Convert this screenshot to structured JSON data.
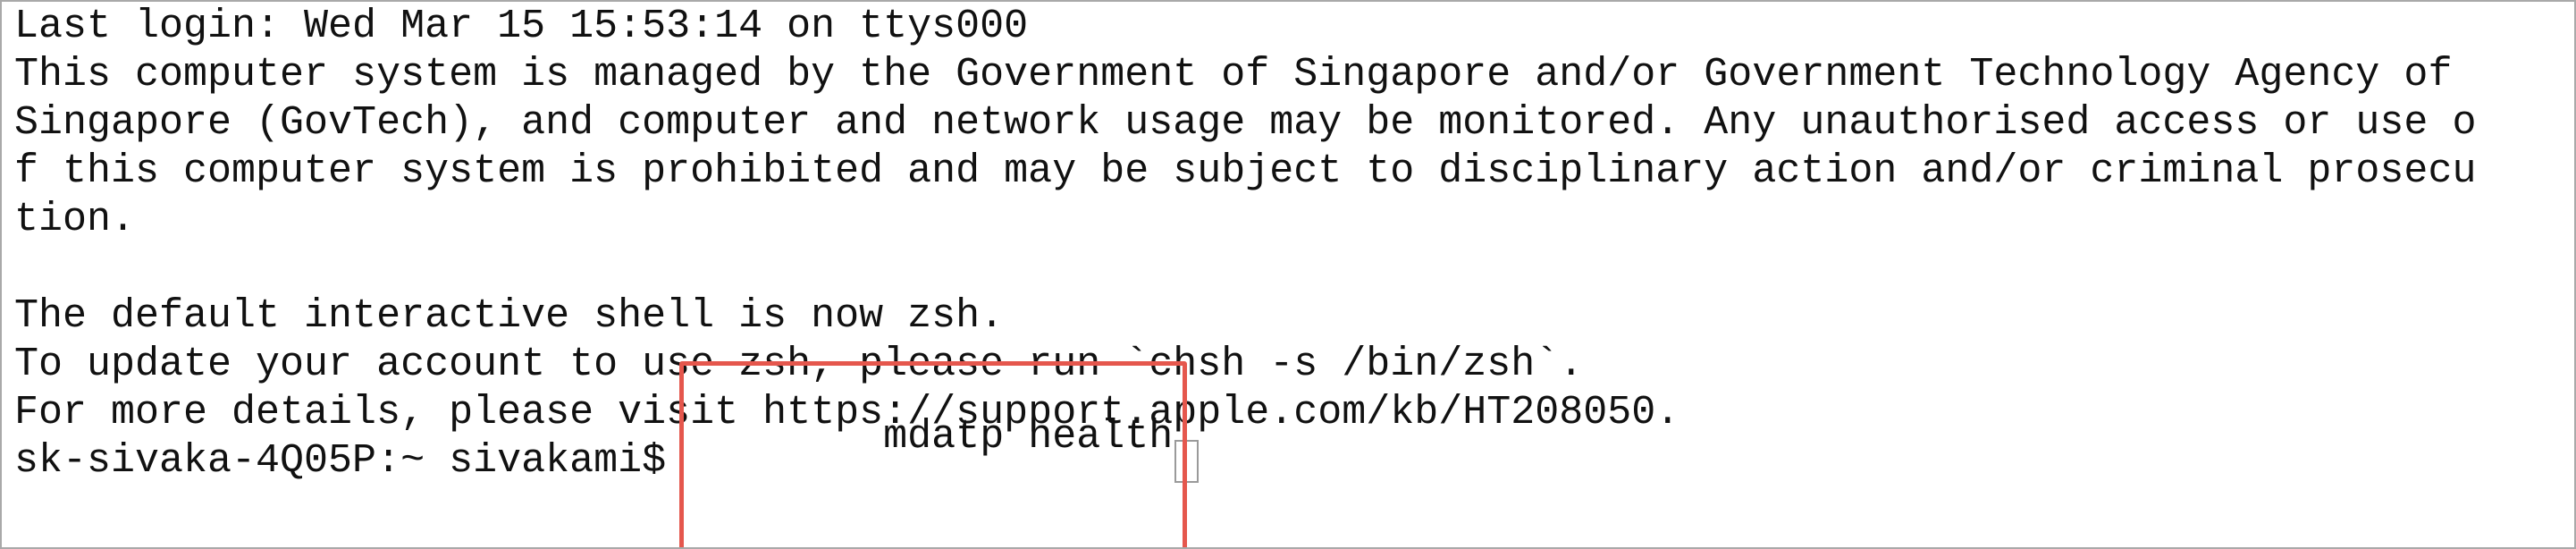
{
  "terminal": {
    "lines": [
      "Last login: Wed Mar 15 15:53:14 on ttys000",
      "This computer system is managed by the Government of Singapore and/or Government Technology Agency of",
      "Singapore (GovTech), and computer and network usage may be monitored. Any unauthorised access or use o",
      "f this computer system is prohibited and may be subject to disciplinary action and/or criminal prosecu",
      "tion.",
      "",
      "The default interactive shell is now zsh.",
      "To update your account to use zsh, please run `chsh -s /bin/zsh`.",
      "For more details, please visit https://support.apple.com/kb/HT208050."
    ],
    "prompt": "sk-sivaka-4Q05P:~ sivakami$ ",
    "command": "mdatp health",
    "highlight_color": "#e5574d"
  }
}
